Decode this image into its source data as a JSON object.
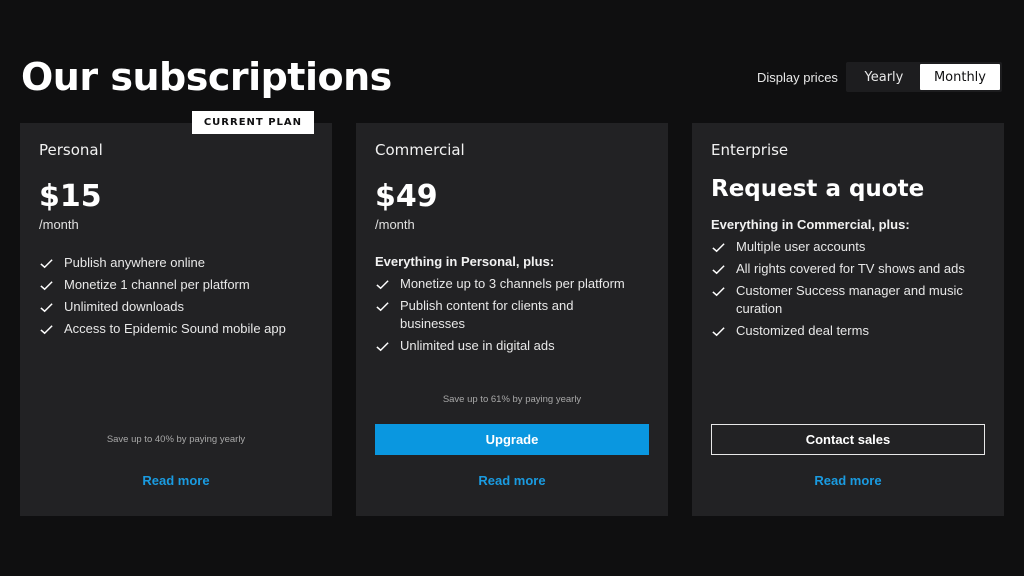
{
  "header": {
    "title": "Our subscriptions",
    "display_prices_label": "Display prices",
    "toggle": {
      "yearly": "Yearly",
      "monthly": "Monthly",
      "selected": "Monthly"
    }
  },
  "plans": [
    {
      "name": "Personal",
      "badge": "CURRENT PLAN",
      "price": "$15",
      "unit": "/month",
      "features": [
        "Publish anywhere online",
        "Monetize 1 channel per platform",
        "Unlimited downloads",
        "Access to Epidemic Sound mobile app"
      ],
      "save_note": "Save up to 40% by paying yearly",
      "read_more": "Read more"
    },
    {
      "name": "Commercial",
      "price": "$49",
      "unit": "/month",
      "intro": "Everything in Personal, plus:",
      "features": [
        "Monetize up to 3 channels per platform",
        "Publish content for clients and businesses",
        "Unlimited use in digital ads"
      ],
      "save_note": "Save up to 61% by paying yearly",
      "cta": "Upgrade",
      "read_more": "Read more"
    },
    {
      "name": "Enterprise",
      "headline": "Request a quote",
      "intro": "Everything in Commercial, plus:",
      "features": [
        "Multiple user accounts",
        "All rights covered for TV shows and ads",
        "Customer Success manager and music curation",
        "Customized deal terms"
      ],
      "cta": "Contact sales",
      "read_more": "Read more"
    }
  ],
  "colors": {
    "background": "#0f0f10",
    "card": "#222224",
    "accent": "#0a97e0",
    "link": "#1a9be0"
  },
  "icons": {
    "feature": "checkmark-icon"
  }
}
